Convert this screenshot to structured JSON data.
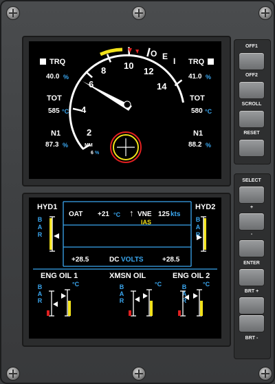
{
  "upper": {
    "left": {
      "trq_label": "TRQ",
      "trq_value": "40.0",
      "trq_unit": "%",
      "tot_label": "TOT",
      "tot_value": "585",
      "tot_unit": "°C",
      "n1_label": "N1",
      "n1_value": "87.3",
      "n1_unit": "%"
    },
    "right": {
      "trq_label": "TRQ",
      "trq_value": "41.0",
      "trq_unit": "%",
      "tot_label": "TOT",
      "tot_value": "580",
      "tot_unit": "°C",
      "n1_label": "N1",
      "n1_value": "88.2",
      "n1_unit": "%"
    },
    "dial": {
      "ticks": [
        "2",
        "4",
        "6",
        "8",
        "10",
        "12",
        "14"
      ],
      "oei_labels": [
        "O",
        "E",
        "I"
      ]
    },
    "mm_label": "MM",
    "mm_value": "6",
    "mm_unit": "%"
  },
  "lower": {
    "hyd1": "HYD1",
    "hyd2": "HYD2",
    "bar_label": "B A R",
    "oat_label": "OAT",
    "oat_value": "+21",
    "oat_unit": "°C",
    "vne_label": "VNE",
    "ias_label": "IAS",
    "vne_value": "125",
    "vne_unit": "kts",
    "dc_left": "+28.5",
    "dc_label": "DC",
    "dc_volts": "VOLTS",
    "dc_right": "+28.5",
    "eng_oil_1": "ENG OIL 1",
    "xmsn_oil": "XMSN OIL",
    "eng_oil_2": "ENG OIL 2",
    "deg_c": "°C"
  },
  "buttons": {
    "off1": "OFF1",
    "off2": "OFF2",
    "scroll": "SCROLL",
    "reset": "RESET",
    "select": "SELECT",
    "plus": "+",
    "minus": "-",
    "enter": "ENTER",
    "brt_plus": "BRT +",
    "brt_minus": "BRT -"
  },
  "colors": {
    "cyan": "#3aa7f0",
    "yellow": "#f2e21a",
    "red": "#e02020",
    "white": "#ffffff"
  }
}
